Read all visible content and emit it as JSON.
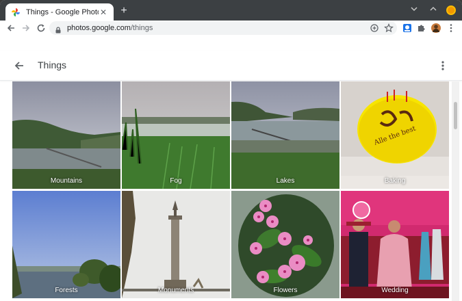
{
  "browser": {
    "tab": {
      "title": "Things - Google Photos",
      "close": "✕"
    },
    "new_tab": "+",
    "url": {
      "host": "photos.google.com",
      "path": "/things"
    }
  },
  "app": {
    "title": "Things",
    "tiles": [
      {
        "label": "Mountains"
      },
      {
        "label": "Fog"
      },
      {
        "label": "Lakes"
      },
      {
        "label": "Baking"
      },
      {
        "label": "Forests"
      },
      {
        "label": "Monuments"
      },
      {
        "label": "Flowers"
      },
      {
        "label": "Wedding"
      }
    ]
  },
  "colors": {
    "accent": "#1a73e8",
    "tab_strip": "#3c4043",
    "omnibox": "#f1f3f4"
  }
}
